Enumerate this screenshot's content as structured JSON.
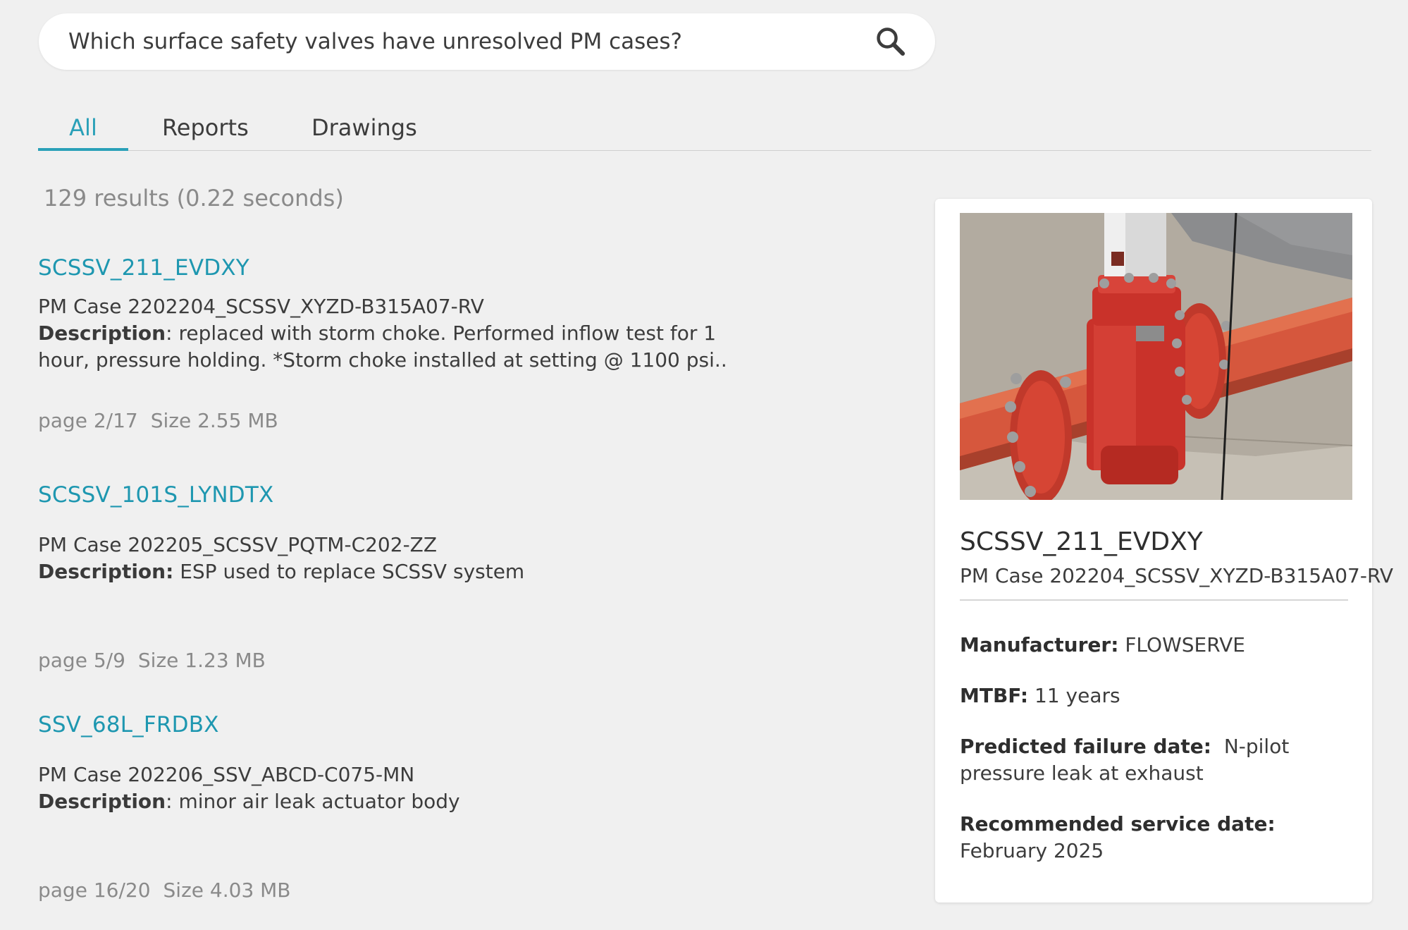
{
  "search": {
    "query": "Which surface safety valves have unresolved PM cases?"
  },
  "tabs": [
    {
      "label": "All",
      "active": true
    },
    {
      "label": "Reports",
      "active": false
    },
    {
      "label": "Drawings",
      "active": false
    }
  ],
  "results_summary": "129 results (0.22 seconds)",
  "results": [
    {
      "title": "SCSSV_211_EVDXY",
      "case": "PM Case 2202204_SCSSV_XYZD-B315A07-RV",
      "description_label": "Description",
      "description_sep": ": ",
      "description": "replaced with storm choke. Performed inflow test for 1 hour, pressure holding. *Storm choke installed at setting @ 1100 psi..",
      "page": "page 2/17",
      "size": "Size 2.55 MB"
    },
    {
      "title": "SCSSV_101S_LYNDTX",
      "case": "PM Case 202205_SCSSV_PQTM-C202-ZZ",
      "description_label": "Description:",
      "description_sep": " ",
      "description": "ESP used to replace SCSSV system",
      "page": "page 5/9",
      "size": "Size 1.23 MB"
    },
    {
      "title": "SSV_68L_FRDBX",
      "case": "PM Case 202206_SSV_ABCD-C075-MN",
      "description_label": "Description",
      "description_sep": ": ",
      "description": "minor air leak actuator body",
      "page": "page 16/20",
      "size": "Size 4.03 MB"
    }
  ],
  "detail": {
    "title": "SCSSV_211_EVDXY",
    "subtitle": "PM Case 202204_SCSSV_XYZD-B315A07-RV",
    "manufacturer_label": "Manufacturer:",
    "manufacturer": "FLOWSERVE",
    "mtbf_label": "MTBF:",
    "mtbf": "11 years",
    "failure_label": "Predicted failure date:",
    "failure": "N-pilot pressure leak at exhaust",
    "service_label": "Recommended service date:",
    "service": "February 2025"
  },
  "colors": {
    "accent": "#1e97b0",
    "background": "#f0f0f0",
    "card": "#ffffff",
    "muted_text": "#8a8a8a"
  }
}
